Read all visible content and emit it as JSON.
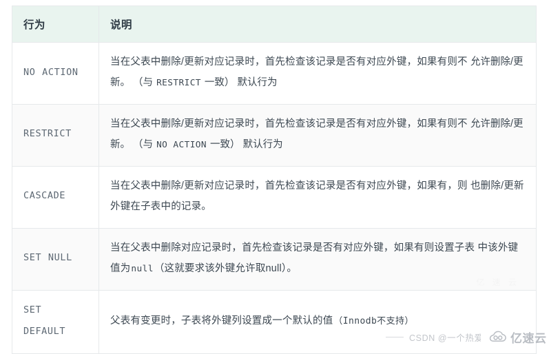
{
  "table": {
    "columns": [
      {
        "key": "action",
        "label": "行为"
      },
      {
        "key": "desc",
        "label": "说明"
      }
    ],
    "rows": [
      {
        "action": "NO ACTION",
        "desc_line1": "当在父表中删除/更新对应记录时，首先检查该记录是否有对应外键，如果有则不",
        "desc_line2_pre": "允许删除/更新。 （与 ",
        "desc_code": "RESTRICT",
        "desc_line2_post": " 一致） 默认行为"
      },
      {
        "action": "RESTRICT",
        "desc_line1": "当在父表中删除/更新对应记录时，首先检查该记录是否有对应外键，如果有则不",
        "desc_line2_pre": "允许删除/更新。 （与 ",
        "desc_code": "NO ACTION",
        "desc_line2_post": " 一致） 默认行为"
      },
      {
        "action": "CASCADE",
        "desc_line1": "当在父表中删除/更新对应记录时，首先检查该记录是否有对应外键，如果有，则",
        "desc_line2_pre": "也删除/更新外键在子表中的记录。",
        "desc_code": "",
        "desc_line2_post": ""
      },
      {
        "action": "SET NULL",
        "desc_line1": "当在父表中删除对应记录时，首先检查该记录是否有对应外键，如果有则设置子表",
        "desc_line2_pre": "中该外键值为",
        "desc_code": "null",
        "desc_line2_post": "（这就要求该外键允许取null）。"
      },
      {
        "action": "SET DEFAULT",
        "desc_line1": "父表有变更时，子表将外键列设置成一个默认的值",
        "desc_line2_pre": "",
        "desc_code": "",
        "desc_line2_post": "（Innodb不支持）"
      }
    ]
  },
  "watermark": {
    "csdn_text": "CSDN @一个热爱",
    "brand": "亿速云",
    "logo_icon": "cloud-icon",
    "faint_mark": "亿 速 云"
  },
  "colors": {
    "header_bg": "#e9f4ef",
    "row_alt_bg": "#fafafa",
    "border": "#e6e9eb",
    "action_text": "#5d6873",
    "desc_text": "#3d4852",
    "watermark_text": "#c3c6cb"
  }
}
